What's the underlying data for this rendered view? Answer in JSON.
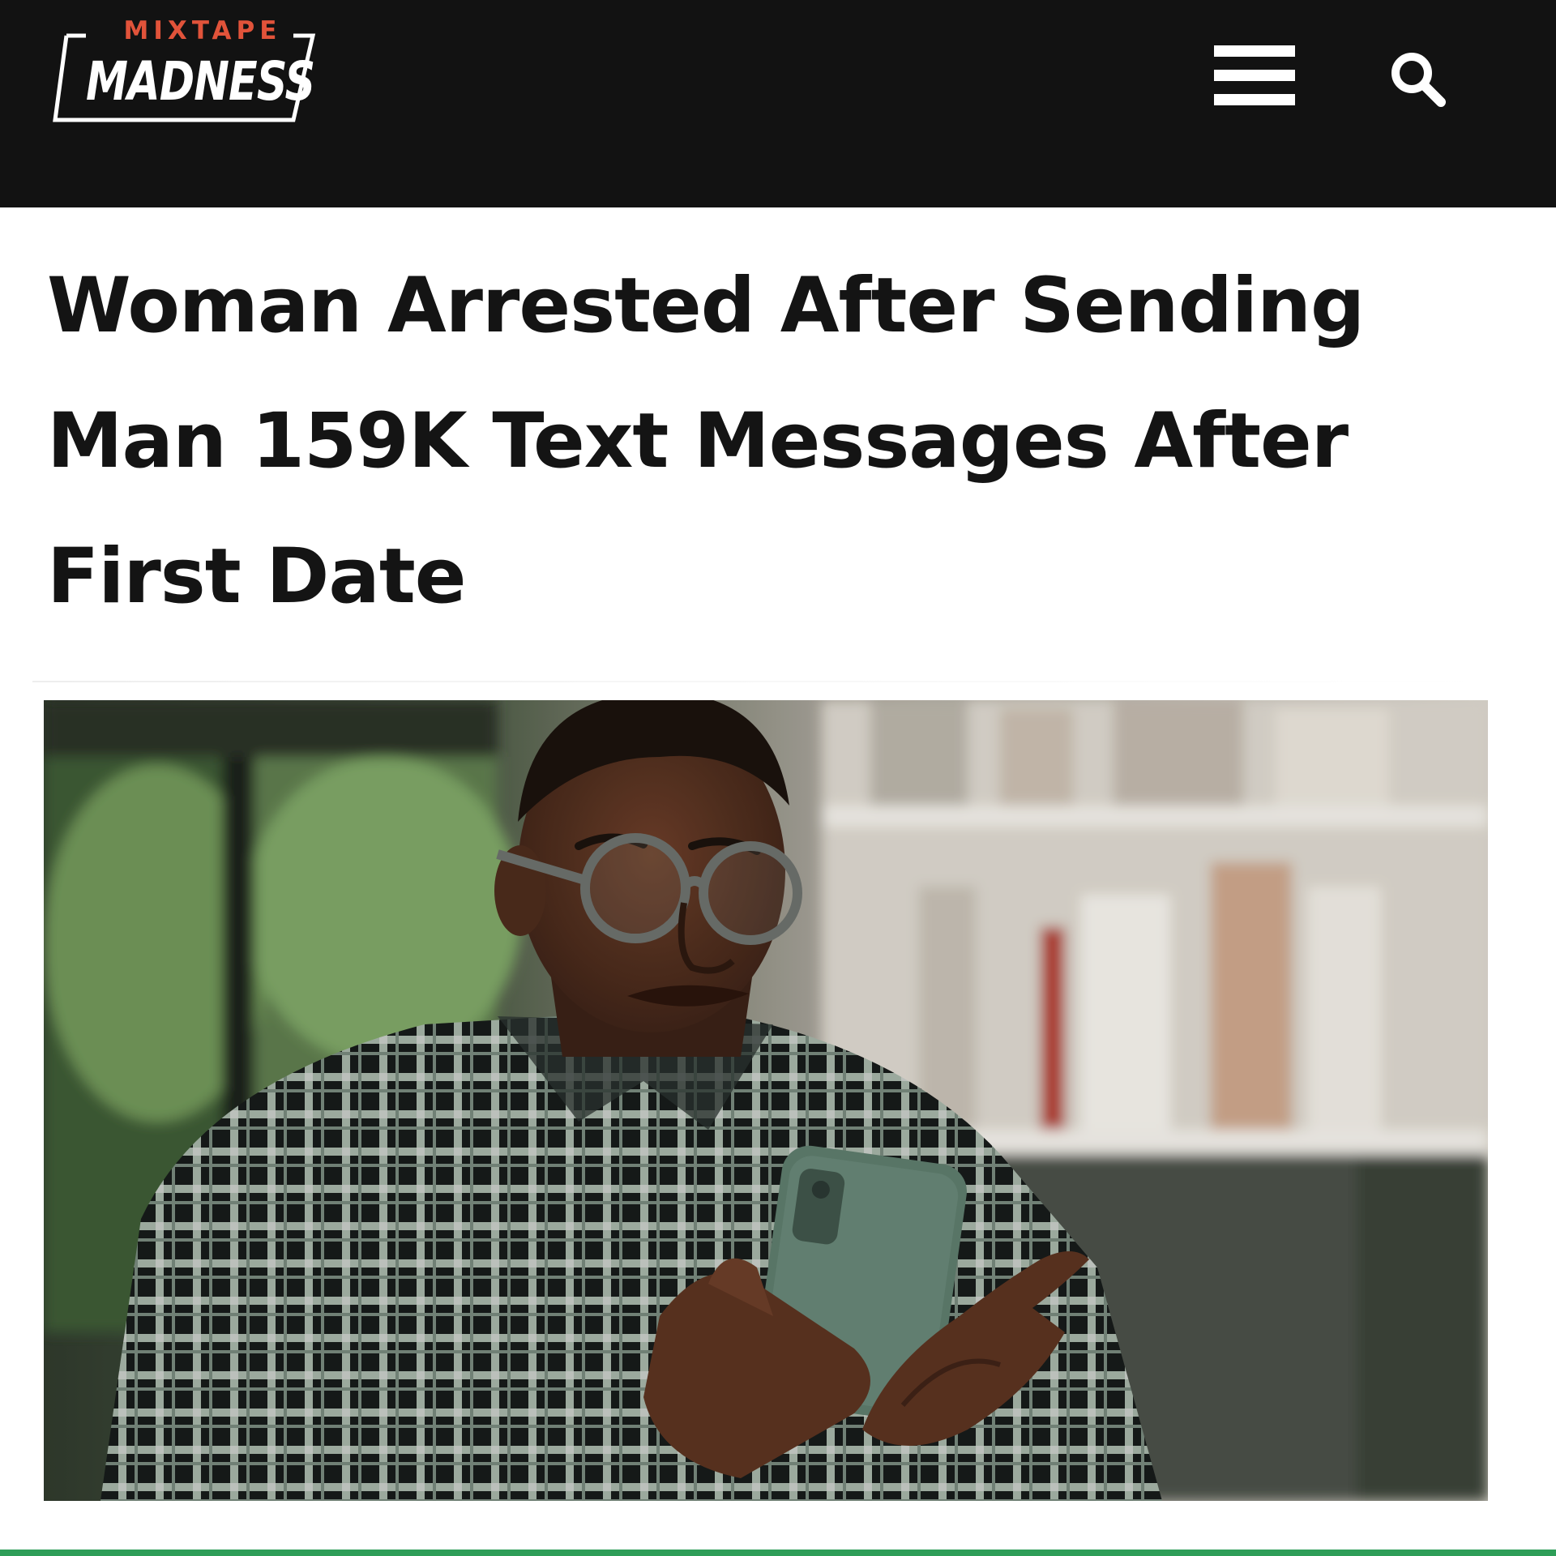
{
  "site": {
    "logo_top": "MIXTAPE",
    "logo_main": "MADNESS",
    "colors": {
      "header_bg": "#121212",
      "logo_accent": "#e1533a",
      "text": "#141414"
    }
  },
  "header": {
    "menu_icon": "hamburger-menu-icon",
    "search_icon": "search-icon"
  },
  "article": {
    "headline_lines": [
      "Woman Arrested After Sending",
      "Man 159K Text Messages After",
      "First Date"
    ],
    "image": {
      "subject": "man-with-glasses-looking-at-phone"
    }
  }
}
